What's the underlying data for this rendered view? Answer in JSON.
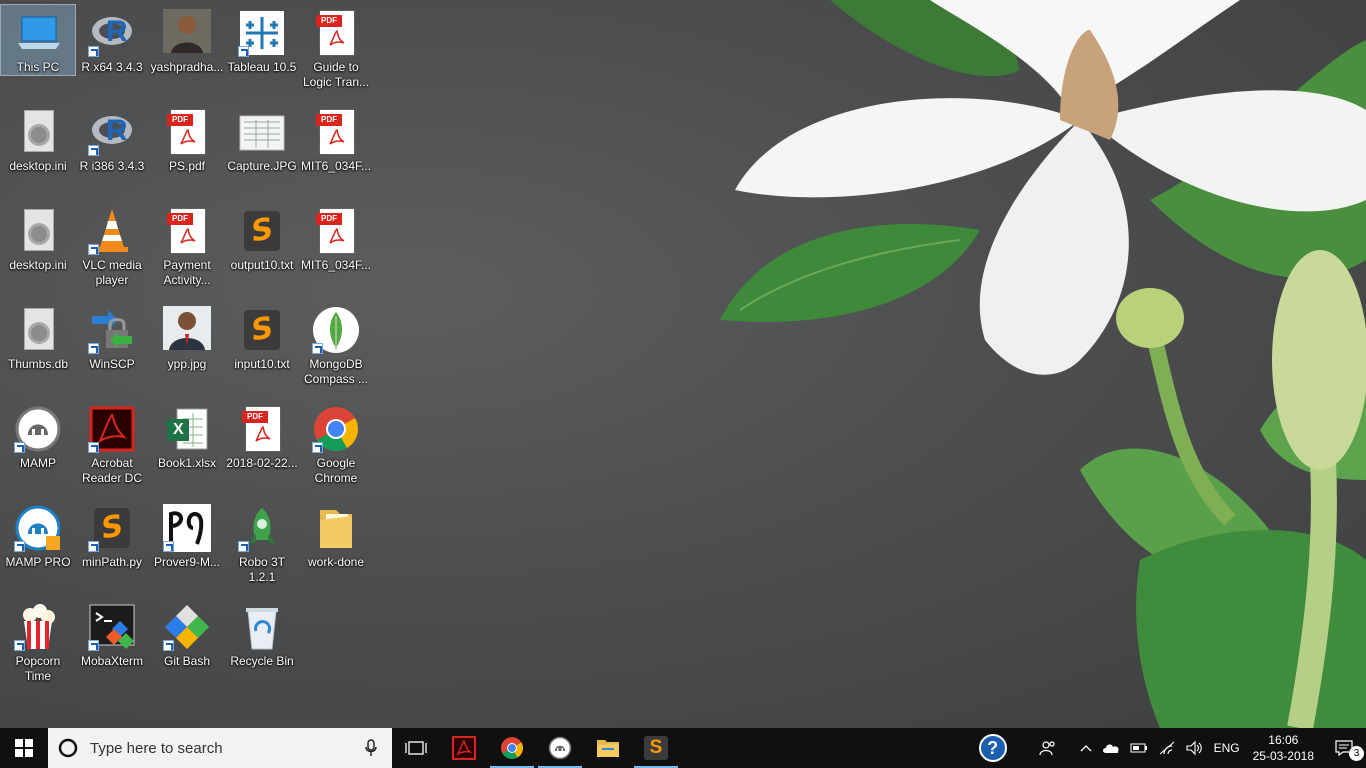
{
  "desktop": {
    "icons": [
      {
        "label": "This PC"
      },
      {
        "label": "R x64 3.4.3"
      },
      {
        "label": "yashpradha..."
      },
      {
        "label": "Tableau 10.5"
      },
      {
        "label": "Guide to\nLogic Tran..."
      },
      {
        "label": "desktop.ini"
      },
      {
        "label": "R i386 3.4.3"
      },
      {
        "label": "PS.pdf"
      },
      {
        "label": "Capture.JPG"
      },
      {
        "label": "MIT6_034F..."
      },
      {
        "label": "desktop.ini"
      },
      {
        "label": "VLC media\nplayer"
      },
      {
        "label": "Payment\nActivity..."
      },
      {
        "label": "output10.txt"
      },
      {
        "label": "MIT6_034F..."
      },
      {
        "label": "Thumbs.db"
      },
      {
        "label": "WinSCP"
      },
      {
        "label": "ypp.jpg"
      },
      {
        "label": "input10.txt"
      },
      {
        "label": "MongoDB\nCompass ..."
      },
      {
        "label": "MAMP"
      },
      {
        "label": "Acrobat\nReader DC"
      },
      {
        "label": "Book1.xlsx"
      },
      {
        "label": "2018-02-22..."
      },
      {
        "label": "Google\nChrome"
      },
      {
        "label": "MAMP PRO"
      },
      {
        "label": "minPath.py"
      },
      {
        "label": "Prover9-M..."
      },
      {
        "label": "Robo 3T 1.2.1"
      },
      {
        "label": "work-done"
      },
      {
        "label": "Popcorn\nTime"
      },
      {
        "label": "MobaXterm"
      },
      {
        "label": "Git Bash"
      },
      {
        "label": "Recycle Bin"
      }
    ],
    "pdf_tag": "PDF",
    "sublime_glyph": "S",
    "excel_glyph": "X",
    "r_glyph": "R"
  },
  "taskbar": {
    "search_placeholder": "Type here to search",
    "language": "ENG",
    "time": "16:06",
    "date": "25-03-2018",
    "notification_count": "3",
    "help_glyph": "?",
    "accent": "#76b9ed"
  }
}
